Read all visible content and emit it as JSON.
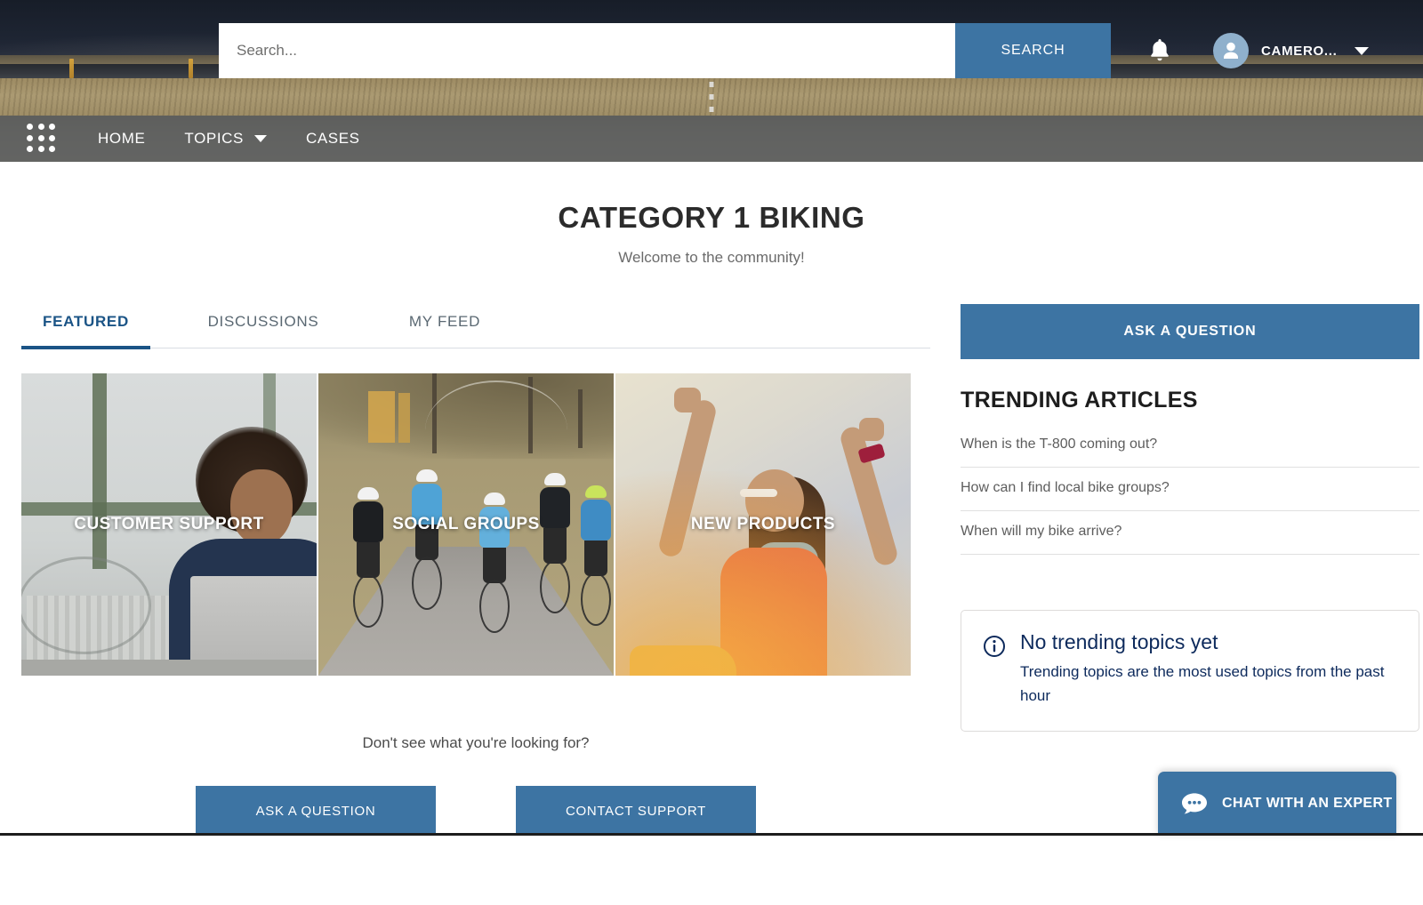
{
  "header": {
    "search": {
      "placeholder": "Search...",
      "value": "",
      "button_label": "SEARCH"
    },
    "notifications_icon": "bell-icon",
    "avatar_icon": "user-avatar-icon",
    "user_name": "CAMERO...",
    "user_menu_icon": "chevron-down-icon"
  },
  "nav": {
    "app_launcher_icon": "app-launcher-waffle-icon",
    "items": [
      {
        "label": "HOME",
        "has_caret": false
      },
      {
        "label": "TOPICS",
        "has_caret": true
      },
      {
        "label": "CASES",
        "has_caret": false
      }
    ]
  },
  "page": {
    "title": "CATEGORY 1 BIKING",
    "subtitle": "Welcome to the community!"
  },
  "tabs": [
    {
      "label": "FEATURED",
      "active": true
    },
    {
      "label": "DISCUSSIONS",
      "active": false
    },
    {
      "label": "MY FEED",
      "active": false
    }
  ],
  "featured_cards": [
    {
      "label": "CUSTOMER SUPPORT"
    },
    {
      "label": "SOCIAL GROUPS"
    },
    {
      "label": "NEW PRODUCTS"
    }
  ],
  "footer": {
    "note": "Don't see what you're looking for?",
    "ask_label": "ASK A QUESTION",
    "contact_label": "CONTACT SUPPORT"
  },
  "sidebar": {
    "ask_label": "ASK A QUESTION",
    "trending_heading": "TRENDING ARTICLES",
    "articles": [
      "When is the T-800 coming out?",
      "How can I find local bike groups?",
      "When will my bike arrive?"
    ],
    "info": {
      "icon": "info-circle-icon",
      "title": "No trending topics yet",
      "description": "Trending topics are the most used topics from the past hour"
    }
  },
  "chat": {
    "icon": "chat-bubble-icon",
    "label": "CHAT WITH AN EXPERT"
  },
  "colors": {
    "accent_blue": "#3d74a3",
    "active_tab_blue": "#1b5486",
    "info_navy": "#0d2a5c",
    "nav_overlay": "rgba(104,104,100,0.78)"
  }
}
